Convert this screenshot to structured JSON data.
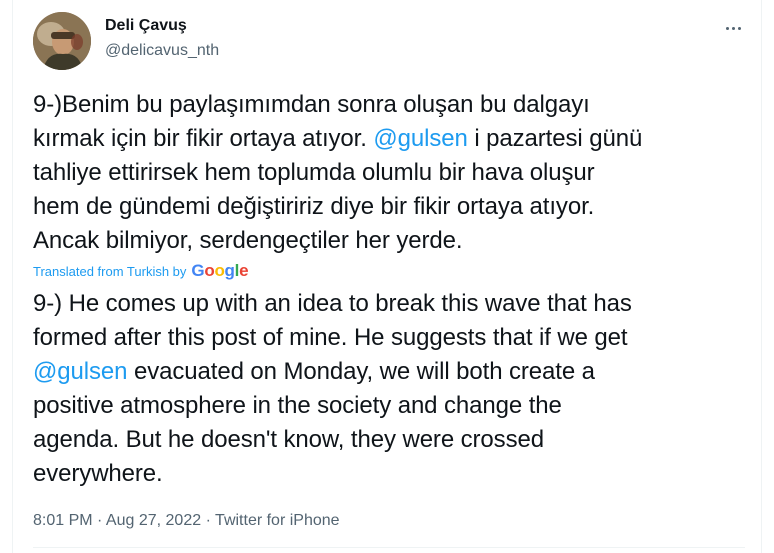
{
  "author": {
    "display_name": "Deli Çavuş",
    "handle": "@delicavus_nth",
    "avatar_icon": "user-avatar"
  },
  "more_icon": "more-horizontal-icon",
  "original_text": {
    "lines": [
      [
        {
          "text": "9-)Benim bu paylaşımımdan sonra oluşan bu dalgayı"
        }
      ],
      [
        {
          "text": "kırmak için bir fikir ortaya atıyor. "
        },
        {
          "text": "@gulsen",
          "mention": true
        },
        {
          "text": " i pazartesi günü"
        }
      ],
      [
        {
          "text": "tahliye ettirirsek hem toplumda olumlu bir hava oluşur"
        }
      ],
      [
        {
          "text": "hem de gündemi değiştiririz diye bir fikir ortaya atıyor."
        }
      ],
      [
        {
          "text": "Ancak bilmiyor, serdengeçtiler her yerde."
        }
      ]
    ]
  },
  "translation_notice": {
    "label": "Translated from Turkish by",
    "provider_letters": [
      "G",
      "o",
      "o",
      "g",
      "l",
      "e"
    ]
  },
  "translated_text": {
    "lines": [
      [
        {
          "text": "9-) He comes up with an idea to break this wave that has"
        }
      ],
      [
        {
          "text": "formed after this post of mine. He suggests that if we get"
        }
      ],
      [
        {
          "text": "@gulsen",
          "mention": true
        },
        {
          "text": " evacuated on Monday, we will both create a"
        }
      ],
      [
        {
          "text": "positive atmosphere in the society and change the"
        }
      ],
      [
        {
          "text": "agenda. But he doesn't know, they were crossed"
        }
      ],
      [
        {
          "text": "everywhere."
        }
      ]
    ]
  },
  "meta": {
    "text": "8:01 PM · Aug 27, 2022 · Twitter for iPhone"
  },
  "colors": {
    "text": "#0f1419",
    "secondary": "#536471",
    "link": "#1d9bf0"
  }
}
